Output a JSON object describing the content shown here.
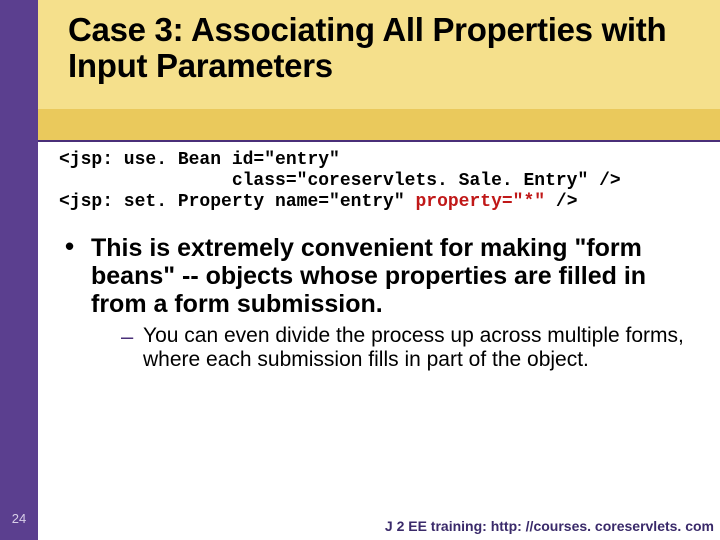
{
  "title": "Case 3: Associating All Properties with Input Parameters",
  "code": {
    "line1a": "<jsp: use. Bean id=\"entry\"",
    "line1b": "                class=\"coreservlets. Sale. Entry\" />",
    "line2a": "<jsp: set. Property name=\"entry\" ",
    "line2b": "property=\"*\"",
    "line2c": " />"
  },
  "bullets": {
    "b1": "This is extremely convenient for making \"form beans\" -- objects whose properties are filled in from a form submission.",
    "b2": "You can even divide the process up across multiple forms, where each submission fills in part of the object."
  },
  "page_number": "24",
  "footer": "J 2 EE training: http: //courses. coreservlets. com"
}
